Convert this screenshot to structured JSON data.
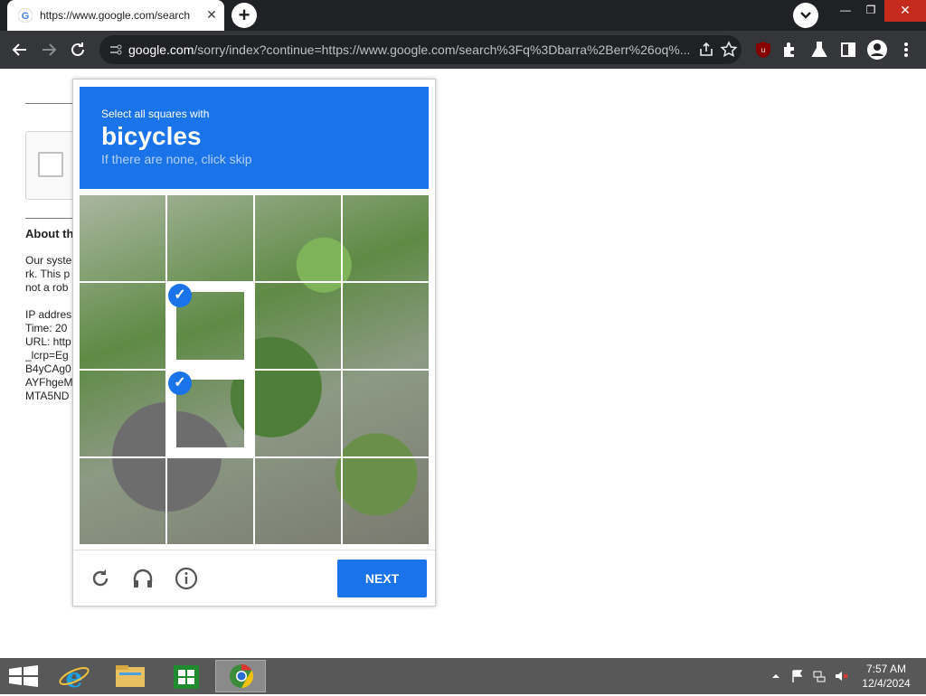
{
  "browser": {
    "tab_title": "https://www.google.com/search",
    "url_host": "google.com",
    "url_rest": "/sorry/index?continue=https://www.google.com/search%3Fq%3Dbarra%2Berr%26oq%...",
    "icons": [
      "back-arrow-icon",
      "forward-arrow-icon",
      "reload-icon",
      "site-info-icon",
      "share-icon",
      "bookmark-star-icon",
      "ublock-icon",
      "extensions-icon",
      "labs-flask-icon",
      "side-panel-icon",
      "profile-icon",
      "menu-kebab-icon"
    ]
  },
  "background_page": {
    "heading": "About th",
    "para_lines": [
      "Our syste",
      "rk. This p",
      "not a rob"
    ],
    "info_lines": [
      "IP addres",
      "Time: 20",
      "URL: http",
      "_lcrp=Eg",
      "B4yCAg0",
      "AYFhgeM",
      "MTA5ND"
    ]
  },
  "captcha": {
    "instruction": "Select all squares with",
    "target": "bicycles",
    "hint": "If there are none, click skip",
    "selected_tiles": [
      5,
      9
    ],
    "next_label": "NEXT",
    "footer_icons": [
      "reload-icon",
      "audio-headphones-icon",
      "info-icon"
    ],
    "colors": {
      "accent": "#1a73e8"
    }
  },
  "taskbar": {
    "apps": [
      "start-windows-icon",
      "internet-explorer-icon",
      "file-explorer-icon",
      "store-icon",
      "chrome-icon"
    ],
    "time": "7:57 AM",
    "date": "12/4/2024"
  }
}
